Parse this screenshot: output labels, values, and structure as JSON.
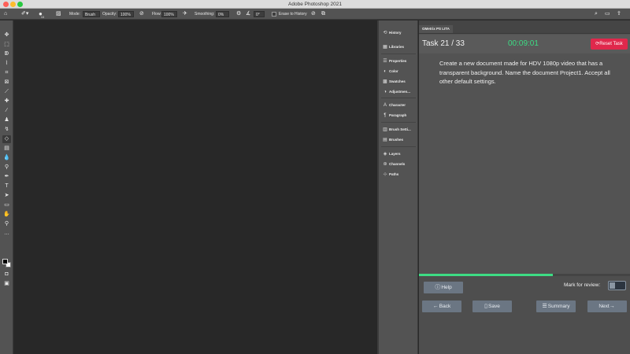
{
  "window": {
    "title": "Adobe Photoshop 2021"
  },
  "options_bar": {
    "mode_label": "Mode:",
    "mode_value": "Brush",
    "opacity_label": "Opacity:",
    "opacity_value": "100%",
    "flow_label": "Flow:",
    "flow_value": "100%",
    "smoothing_label": "Smoothing:",
    "smoothing_value": "0%",
    "angle_value": "0°",
    "erase_history_label": "Erase to History",
    "brush_size": "13",
    "active_tool_icon": "eraser-icon"
  },
  "dock": {
    "items": [
      {
        "label": "History",
        "icon": "history-icon"
      },
      {
        "label": "Libraries",
        "icon": "libraries-icon"
      },
      {
        "label": "Properties",
        "icon": "properties-icon"
      },
      {
        "label": "Color",
        "icon": "color-icon"
      },
      {
        "label": "Swatches",
        "icon": "swatches-icon"
      },
      {
        "label": "Adjustmen...",
        "icon": "adjustments-icon"
      },
      {
        "label": "Character",
        "icon": "character-icon"
      },
      {
        "label": "Paragraph",
        "icon": "paragraph-icon"
      },
      {
        "label": "Brush Setti...",
        "icon": "brush-settings-icon"
      },
      {
        "label": "Brushes",
        "icon": "brushes-icon"
      },
      {
        "label": "Layers",
        "icon": "layers-icon"
      },
      {
        "label": "Channels",
        "icon": "channels-icon"
      },
      {
        "label": "Paths",
        "icon": "paths-icon"
      }
    ]
  },
  "plugin": {
    "tab_label": "GMetrix PS LITA",
    "task_label": "Task 21 / 33",
    "timer": "00:09:01",
    "reset_label": "Reset Task",
    "task_text": "Create a new document made for HDV 1080p video that has a transparent background. Name the document Project1. Accept all other default settings.",
    "progress_fraction": 0.636,
    "help_label": "Help",
    "review_label": "Mark for review:",
    "back_label": "Back",
    "save_label": "Save",
    "summary_label": "Summary",
    "next_label": "Next"
  },
  "colors": {
    "accent_green": "#3ddc84",
    "reset_red": "#e0284c",
    "button_gray": "#6b7683"
  }
}
